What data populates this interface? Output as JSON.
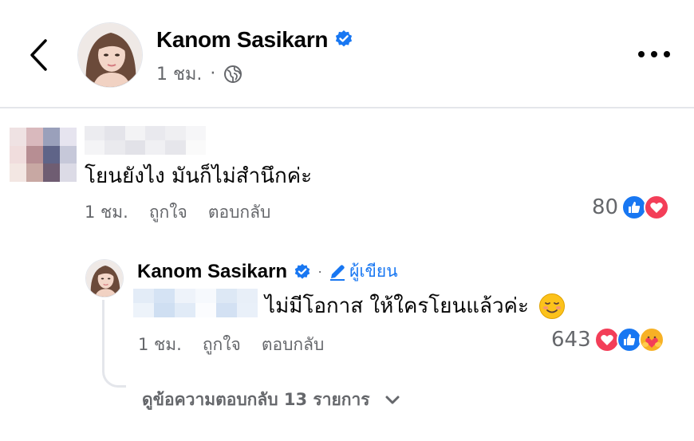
{
  "post_header": {
    "author": "Kanom Sasikarn",
    "time": "1 ชม.",
    "separator": "·",
    "icons": {
      "back": "chevron-left-icon",
      "verified": "verified-badge-icon",
      "audience": "globe-icon",
      "more": "more-horizontal-icon"
    }
  },
  "comments": [
    {
      "text": "โยนยังไง มันก็ไม่สำนึกค่ะ",
      "actions": {
        "time": "1 ชม.",
        "like": "ถูกใจ",
        "reply": "ตอบกลับ"
      },
      "reaction_count": "80",
      "reactions": [
        "like",
        "love"
      ],
      "replies": [
        {
          "author": "Kanom Sasikarn",
          "author_badge": "ผู้เขียน",
          "separator": "·",
          "text": "ไม่มีโอกาส ให้ใครโยนแล้วค่ะ",
          "emoji": "☺️",
          "actions": {
            "time": "1 ชม.",
            "like": "ถูกใจ",
            "reply": "ตอบกลับ"
          },
          "reaction_count": "643",
          "reactions": [
            "love",
            "like",
            "care"
          ]
        }
      ],
      "view_more_replies": "ดูข้อความตอบกลับ 13 รายการ"
    }
  ],
  "colors": {
    "facebook_blue": "#1877f2",
    "love_red": "#f33e58",
    "care_yellow": "#f7b125",
    "secondary_text": "#65676b"
  }
}
